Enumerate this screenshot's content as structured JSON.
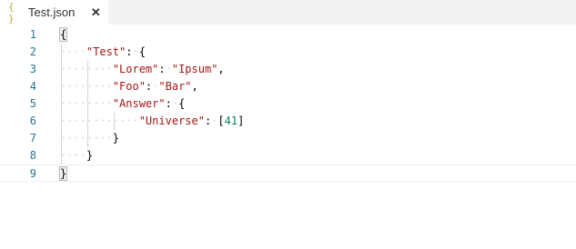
{
  "tab": {
    "icon": "{ }",
    "title": "Test.json",
    "close": "✕"
  },
  "editor": {
    "line_numbers": [
      "1",
      "2",
      "3",
      "4",
      "5",
      "6",
      "7",
      "8",
      "9"
    ],
    "lines": [
      {
        "indent": 0,
        "tokens": [
          {
            "t": "{",
            "c": "p bm"
          }
        ]
      },
      {
        "indent": 4,
        "tokens": [
          {
            "t": "\"Test\"",
            "c": "key"
          },
          {
            "t": ":",
            "c": "p"
          },
          {
            "t": "·",
            "c": "ws"
          },
          {
            "t": "{",
            "c": "p"
          }
        ]
      },
      {
        "indent": 8,
        "tokens": [
          {
            "t": "\"Lorem\"",
            "c": "key"
          },
          {
            "t": ":",
            "c": "p"
          },
          {
            "t": "·",
            "c": "ws"
          },
          {
            "t": "\"Ipsum\"",
            "c": "str"
          },
          {
            "t": ",",
            "c": "p"
          }
        ]
      },
      {
        "indent": 8,
        "tokens": [
          {
            "t": "\"Foo\"",
            "c": "key"
          },
          {
            "t": ":",
            "c": "p"
          },
          {
            "t": "·",
            "c": "ws"
          },
          {
            "t": "\"Bar\"",
            "c": "str"
          },
          {
            "t": ",",
            "c": "p"
          }
        ]
      },
      {
        "indent": 8,
        "tokens": [
          {
            "t": "\"Answer\"",
            "c": "key"
          },
          {
            "t": ":",
            "c": "p"
          },
          {
            "t": "·",
            "c": "ws"
          },
          {
            "t": "{",
            "c": "p"
          }
        ]
      },
      {
        "indent": 12,
        "tokens": [
          {
            "t": "\"Universe\"",
            "c": "key"
          },
          {
            "t": ":",
            "c": "p"
          },
          {
            "t": "·",
            "c": "ws"
          },
          {
            "t": "[",
            "c": "p"
          },
          {
            "t": "41",
            "c": "num"
          },
          {
            "t": "]",
            "c": "p"
          }
        ]
      },
      {
        "indent": 8,
        "tokens": [
          {
            "t": "}",
            "c": "p"
          }
        ]
      },
      {
        "indent": 4,
        "tokens": [
          {
            "t": "}",
            "c": "p"
          }
        ]
      },
      {
        "indent": 0,
        "tokens": [
          {
            "t": "}",
            "c": "p bm"
          }
        ]
      }
    ],
    "current_line": 9
  }
}
